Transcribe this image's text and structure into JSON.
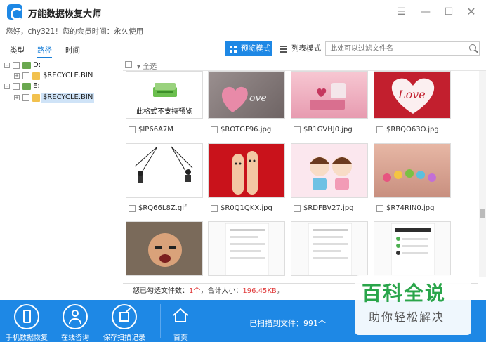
{
  "app": {
    "title": "万能数据恢复大师",
    "welcome": "您好，chy321！您的会员时间：永久使用"
  },
  "window_controls": [
    "menu-icon",
    "minimize-icon",
    "maximize-icon",
    "close-icon"
  ],
  "tabs": [
    {
      "label": "类型"
    },
    {
      "label": "路径",
      "active": true
    },
    {
      "label": "时间"
    }
  ],
  "view": {
    "preview_label": "预览模式",
    "list_label": "列表模式"
  },
  "search": {
    "placeholder": "此处可以过滤文件名"
  },
  "tree": [
    {
      "label": "D:",
      "type": "drive"
    },
    {
      "label": "$RECYCLE.BIN",
      "type": "folder"
    },
    {
      "label": "E:",
      "type": "drive"
    },
    {
      "label": "$RECYCLE.BIN",
      "type": "folder",
      "selected": true
    }
  ],
  "content": {
    "select_all_label": "全选",
    "no_preview_text": "此格式不支持预览",
    "files": [
      {
        "name": "$IP66A7M"
      },
      {
        "name": "$ROTGF96.jpg"
      },
      {
        "name": "$R1GVHJ0.jpg"
      },
      {
        "name": "$RBQO63O.jpg"
      },
      {
        "name": "$RQ66L8Z.gif"
      },
      {
        "name": "$R0Q1QKX.jpg"
      },
      {
        "name": "$RDFBV27.jpg"
      },
      {
        "name": "$R74RIN0.jpg"
      }
    ]
  },
  "status": {
    "prefix": "您已勾选文件数：",
    "count": "1个",
    "middle": "，合计大小：",
    "size": "196.45KB",
    "suffix": "。"
  },
  "bottom": {
    "items": [
      {
        "label": "手机数据恢复"
      },
      {
        "label": "在线咨询"
      },
      {
        "label": "保存扫描记录"
      },
      {
        "label": "首页"
      }
    ],
    "scanned": "已扫描到文件：991个"
  },
  "watermark": {
    "big": "百科全说",
    "small": "助你轻松解决"
  },
  "colors": {
    "accent": "#1e88e5",
    "highlight": "#e03a3a"
  }
}
